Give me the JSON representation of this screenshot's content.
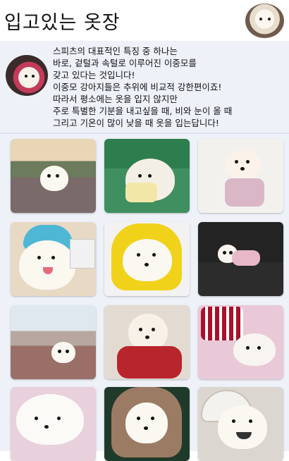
{
  "header": {
    "title": "입고있는 옷장"
  },
  "intro": {
    "lines": [
      "스피츠의 대표적인 특징 중 하나는",
      "바로, 겉털과 속털로 이루어진 이중모를",
      "갖고 있다는 것입니다!",
      "이중모 강아지들은 추위에 비교적 강한편이죠!",
      "따라서 평소에는 옷을 입지 않지만",
      "주로 특별한 기분을 내고싶을 때, 비와 눈이 올 때",
      "그리고 기온이 많이 낮을 때 옷을 입는답니다!"
    ]
  },
  "colors": {
    "panel_bg": "#eef2f8",
    "divider": "#d7e4f5",
    "text": "#111111"
  },
  "icons": {
    "profile": "pomeranian-dog-avatar",
    "intro": "dog-in-sweater-avatar"
  }
}
